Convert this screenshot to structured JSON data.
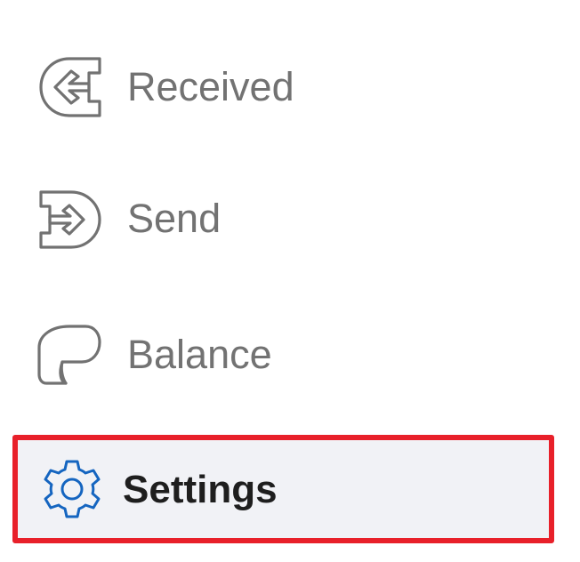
{
  "nav": {
    "items": [
      {
        "key": "received",
        "label": "Received",
        "icon": "received-arrow-icon",
        "active": false
      },
      {
        "key": "send",
        "label": "Send",
        "icon": "send-arrow-icon",
        "active": false
      },
      {
        "key": "balance",
        "label": "Balance",
        "icon": "balance-scroll-icon",
        "active": false
      },
      {
        "key": "settings",
        "label": "Settings",
        "icon": "gear-icon",
        "active": true
      }
    ]
  },
  "colors": {
    "inactive_icon": "#727272",
    "inactive_text": "#727272",
    "active_icon": "#1565c0",
    "active_text": "#1e1e1e",
    "active_background": "#f1f2f6",
    "highlight_border": "#e8202a"
  }
}
